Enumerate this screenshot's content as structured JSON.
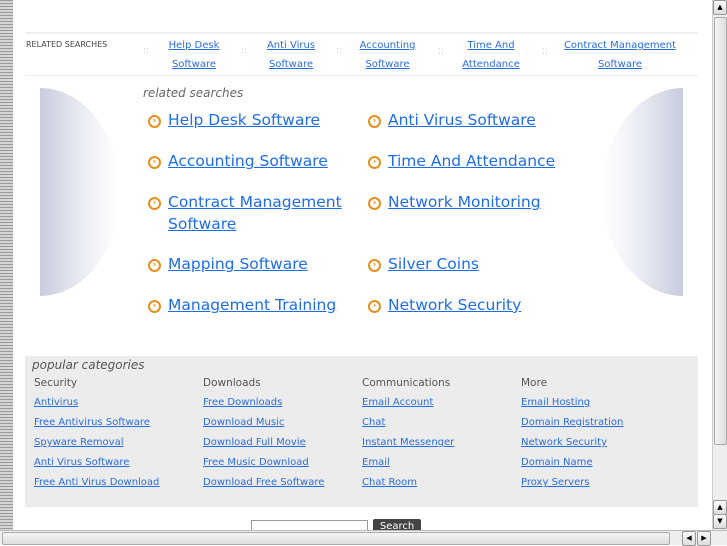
{
  "related_bar": {
    "title": "RELATED SEARCHES",
    "links": [
      [
        "Help Desk",
        "Software"
      ],
      [
        "Anti Virus",
        "Software"
      ],
      [
        "Accounting",
        "Software"
      ],
      [
        "Time And",
        "Attendance"
      ],
      [
        "Contract Management",
        "Software"
      ]
    ]
  },
  "related": {
    "heading": "related searches",
    "links": [
      "Help Desk Software",
      "Anti Virus Software",
      "Accounting Software",
      "Time And Attendance",
      "Contract Management Software",
      "Network Monitoring",
      "Mapping Software",
      "Silver Coins",
      "Management Training",
      "Network Security"
    ]
  },
  "popular": {
    "heading": "popular categories",
    "columns": [
      {
        "title": "Security",
        "links": [
          "Antivirus",
          "Free Antivirus Software",
          "Spyware Removal",
          "Anti Virus Software",
          "Free Anti Virus Download"
        ]
      },
      {
        "title": "Downloads",
        "links": [
          "Free Downloads",
          "Download Music",
          "Download Full Movie",
          "Free Music Download",
          "Download Free Software"
        ]
      },
      {
        "title": "Communications",
        "links": [
          "Email Account",
          "Chat",
          "Instant Messenger",
          "Email",
          "Chat Room"
        ]
      },
      {
        "title": "More",
        "links": [
          "Email Hosting",
          "Domain Registration",
          "Network Security",
          "Domain Name",
          "Proxy Servers"
        ]
      }
    ]
  },
  "search": {
    "button": "Search",
    "value": ""
  },
  "colors": {
    "link": "#1f6ee6",
    "arrow": "#e8901c",
    "panel": "#ececec"
  }
}
